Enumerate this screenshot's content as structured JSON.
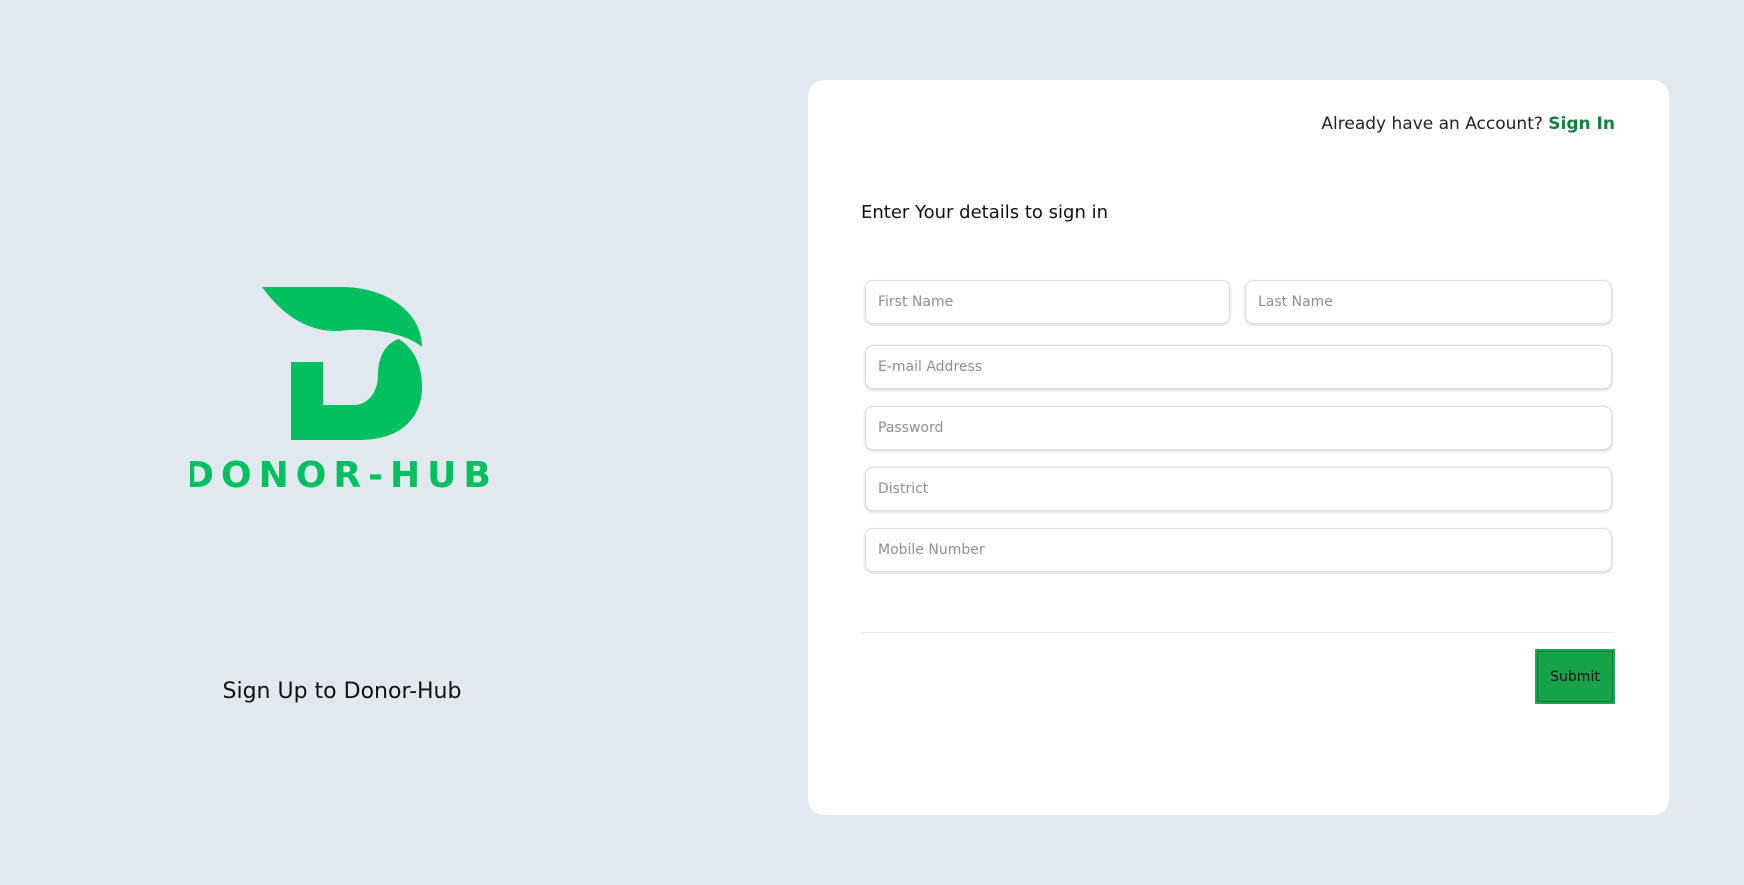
{
  "brand": {
    "logo_text": "DONOR-HUB",
    "caption": "Sign Up to Donor-Hub",
    "color": "#02bf5f"
  },
  "header": {
    "prompt": "Already have an Account?",
    "signin_label": "Sign In"
  },
  "form": {
    "heading": "Enter Your details to sign in",
    "first_name": {
      "placeholder": "First Name",
      "value": ""
    },
    "last_name": {
      "placeholder": "Last Name",
      "value": ""
    },
    "email": {
      "placeholder": "E-mail Address",
      "value": ""
    },
    "password": {
      "placeholder": "Password",
      "value": ""
    },
    "district": {
      "placeholder": "District",
      "value": ""
    },
    "mobile": {
      "placeholder": "Mobile Number",
      "value": ""
    },
    "submit_label": "Submit"
  },
  "colors": {
    "background": "#e1e8f0",
    "accent": "#16a34a",
    "link": "#15803d"
  }
}
